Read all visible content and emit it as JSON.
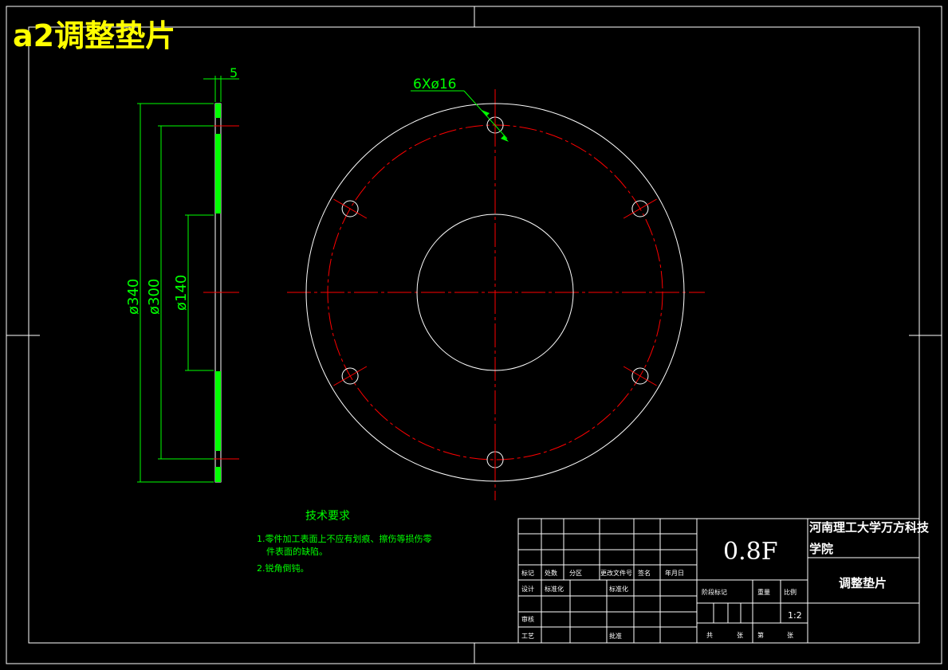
{
  "drawing_title": "a2调整垫片",
  "side_view": {
    "thickness_label": "5",
    "dim_outer": "ø340",
    "dim_bolt_circle": "ø300",
    "dim_inner": "ø140"
  },
  "front_view": {
    "hole_callout": "6Xø16"
  },
  "tech_requirements": {
    "heading": "技术要求",
    "item1_line1": "1.零件加工表面上不应有划痕、擦伤等损伤零",
    "item1_line2": "件表面的缺陷。",
    "item2": "2.锐角倒钝。"
  },
  "title_block": {
    "material": "0.8F",
    "school": "河南理工大学万方科技学院",
    "part_name": "调整垫片",
    "scale": "1:2",
    "col_labels": [
      "标记",
      "处数",
      "分区",
      "更改文件号",
      "签名",
      "年月日"
    ],
    "row_design": "设计",
    "row_standard": "标准化",
    "row_check": "审核",
    "row_process": "工艺",
    "row_approve": "批准",
    "row_std2": "标准化",
    "stage_labels": [
      "阶段标记",
      "重量",
      "比例"
    ],
    "bottom_labels": [
      "共",
      "张",
      "第",
      "张"
    ]
  },
  "colors": {
    "background": "#000000",
    "outline": "#ffffff",
    "centerline": "#ff0000",
    "dimension": "#00ff00",
    "title_yellow": "#ffff00"
  }
}
